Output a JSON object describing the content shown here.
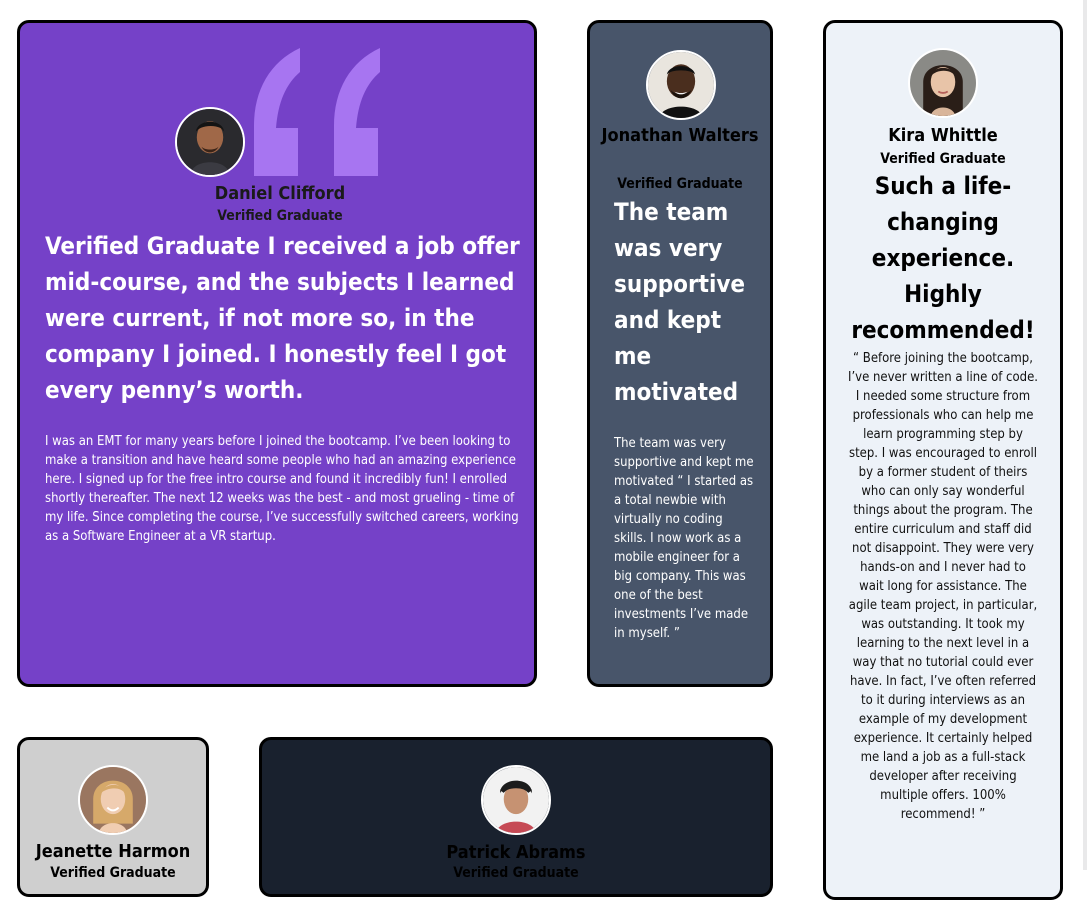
{
  "colors": {
    "purple": "#7541c8",
    "slate": "#48556a",
    "light": "#edf2f8",
    "gray": "#cfcfcf",
    "dark": "#19212e",
    "quote": "#a775f1"
  },
  "testimonials": [
    {
      "name": "Daniel Clifford",
      "role": "Verified Graduate",
      "headline": "Verified Graduate I received a job offer mid-course, and the subjects I learned were current, if not more so, in the company I joined. I honestly feel I got every penny’s worth.",
      "body": "I was an EMT for many years before I joined the bootcamp. I’ve been looking to make a transition and have heard some people who had an amazing experience here. I signed up for the free intro course and found it incredibly fun! I enrolled shortly thereafter. The next 12 weeks was the best - and most grueling - time of my life. Since completing the course, I’ve successfully switched careers, working as a Software Engineer at a VR startup.",
      "avatar_icon": "avatar-daniel"
    },
    {
      "name": "Jonathan Walters",
      "role": "Verified Graduate",
      "headline": "The team was very supportive and kept me motivated",
      "body": "The team was very supportive and kept me motivated “ I started as a total newbie with virtually no coding skills. I now work as a mobile engineer for a big company. This was one of the best investments I’ve made in myself. ”",
      "avatar_icon": "avatar-jonathan"
    },
    {
      "name": "Kira Whittle",
      "role": "Verified Graduate",
      "headline": "Such a life-changing experience. Highly recommended!",
      "body": "“ Before joining the bootcamp, I’ve never written a line of code. I needed some structure from professionals who can help me learn programming step by step. I was encouraged to enroll by a former student of theirs who can only say wonderful things about the program. The entire curriculum and staff did not disappoint. They were very hands-on and I never had to wait long for assistance. The agile team project, in particular, was outstanding. It took my learning to the next level in a way that no tutorial could ever have. In fact, I’ve often referred to it during interviews as an example of my development experience. It certainly helped me land a job as a full-stack developer after receiving multiple offers. 100% recommend! ”",
      "avatar_icon": "avatar-kira"
    },
    {
      "name": "Jeanette Harmon",
      "role": "Verified Graduate",
      "avatar_icon": "avatar-jeanette"
    },
    {
      "name": "Patrick Abrams",
      "role": "Verified Graduate",
      "avatar_icon": "avatar-patrick"
    }
  ]
}
